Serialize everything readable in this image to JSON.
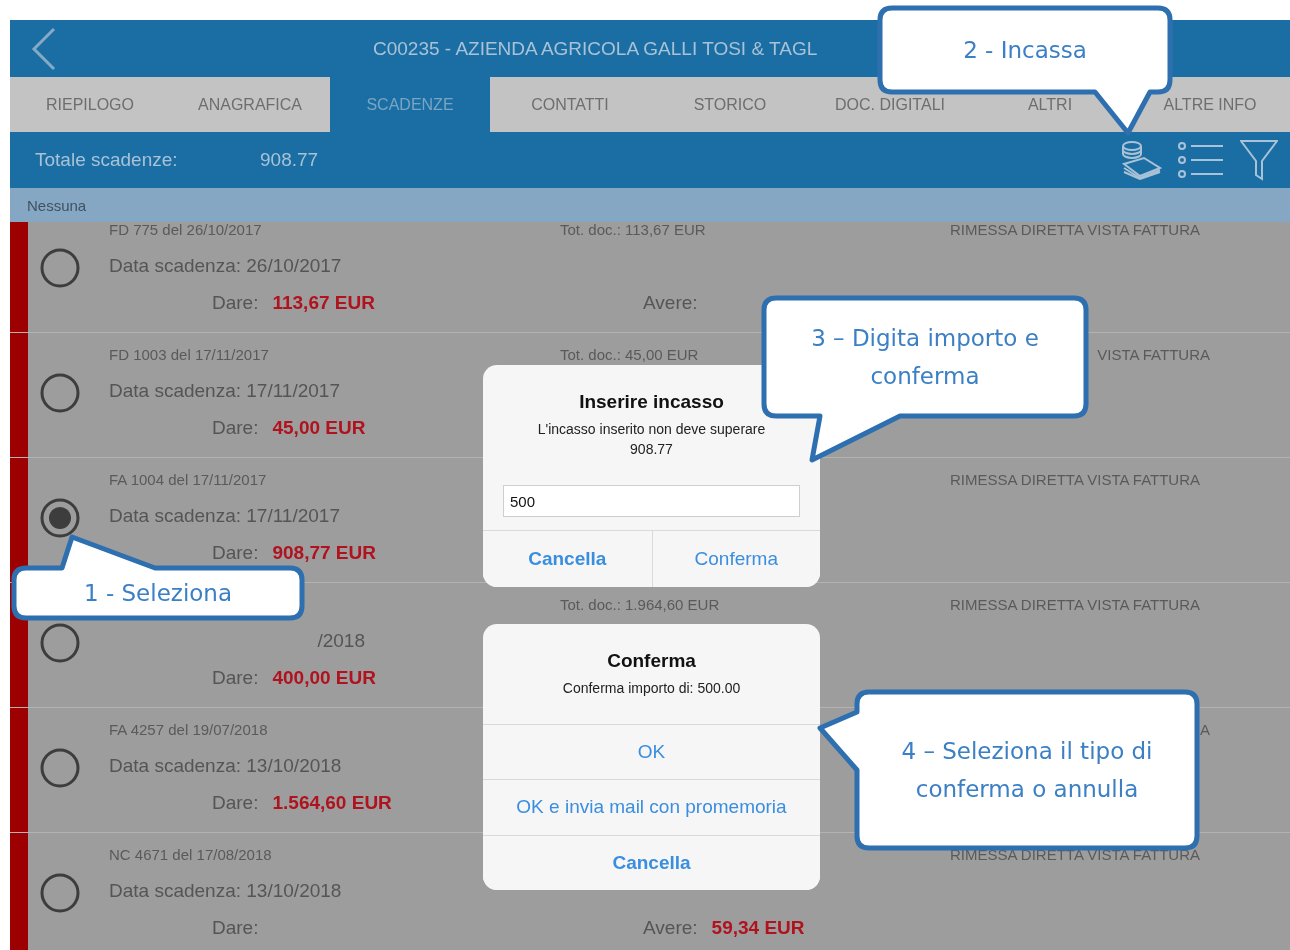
{
  "header": {
    "title": "C00235 - AZIENDA AGRICOLA GALLI TOSI & TAGL"
  },
  "tabs": [
    {
      "label": "RIEPILOGO",
      "selected": false
    },
    {
      "label": "ANAGRAFICA",
      "selected": false
    },
    {
      "label": "SCADENZE",
      "selected": true
    },
    {
      "label": "CONTATTI",
      "selected": false
    },
    {
      "label": "STORICO",
      "selected": false
    },
    {
      "label": "DOC. DIGITALI",
      "selected": false
    },
    {
      "label": "ALTRI",
      "selected": false
    },
    {
      "label": "ALTRE INFO",
      "selected": false
    }
  ],
  "summary": {
    "label": "Totale scadenze:",
    "value": "908.77"
  },
  "filter_bar": {
    "label": "Nessuna"
  },
  "rows": [
    {
      "selected": false,
      "doc": "FD 775 del 26/10/2017",
      "tot_doc": "Tot. doc.: 113,67 EUR",
      "payment": "RIMESSA DIRETTA VISTA FATTURA",
      "date": "Data scadenza: 26/10/2017",
      "dare_label": "Dare:",
      "dare_value": "113,67 EUR",
      "avere_label": "Avere:"
    },
    {
      "selected": false,
      "doc": "FD 1003 del 17/11/2017",
      "tot_doc": "Tot. doc.: 45,00 EUR",
      "payment": "VISTA FATTURA",
      "payment_cut": true,
      "date": "Data scadenza: 17/11/2017",
      "dare_label": "Dare:",
      "dare_value": "45,00 EUR"
    },
    {
      "selected": true,
      "doc": "FA 1004 del 17/11/2017",
      "payment": "RIMESSA DIRETTA VISTA FATTURA",
      "date": "Data scadenza: 17/11/2017",
      "dare_label": "Dare:",
      "dare_value": "908,77 EUR"
    },
    {
      "selected": false,
      "tot_doc": "Tot. doc.: 1.964,60 EUR",
      "payment": "RIMESSA DIRETTA VISTA FATTURA",
      "date": "/2018",
      "date_cut": true,
      "dare_label": "Dare:",
      "dare_value": "400,00 EUR"
    },
    {
      "selected": false,
      "doc": "FA 4257 del 19/07/2018",
      "payment": "A",
      "payment_cut": true,
      "date": "Data scadenza: 13/10/2018",
      "dare_label": "Dare:",
      "dare_value": "1.564,60 EUR"
    },
    {
      "selected": false,
      "doc": "NC 4671 del 17/08/2018",
      "payment": "RIMESSA DIRETTA VISTA FATTURA",
      "date": "Data scadenza: 13/10/2018",
      "dare_label": "Dare:",
      "avere_label": "Avere:",
      "avere_value": "59,34 EUR"
    }
  ],
  "amount_dialog": {
    "title": "Inserire incasso",
    "message": "L'incasso inserito non deve superare 908.77",
    "value": "500",
    "buttons": [
      {
        "label": "Cancella",
        "kind": "cancel"
      },
      {
        "label": "Conferma",
        "kind": "default"
      }
    ]
  },
  "confirm_dialog": {
    "title": "Conferma",
    "message": "Conferma importo di: 500.00",
    "buttons": [
      {
        "label": "OK",
        "kind": "default"
      },
      {
        "label": "OK e invia mail con promemoria",
        "kind": "default"
      },
      {
        "label": "Cancella",
        "kind": "cancel"
      }
    ]
  },
  "callouts": [
    {
      "text": "1 - Seleziona"
    },
    {
      "text": "2 - Incassa"
    },
    {
      "text": "3 – Digita importo e conferma"
    },
    {
      "text": "4 – Seleziona il tipo di conferma o annulla"
    }
  ]
}
